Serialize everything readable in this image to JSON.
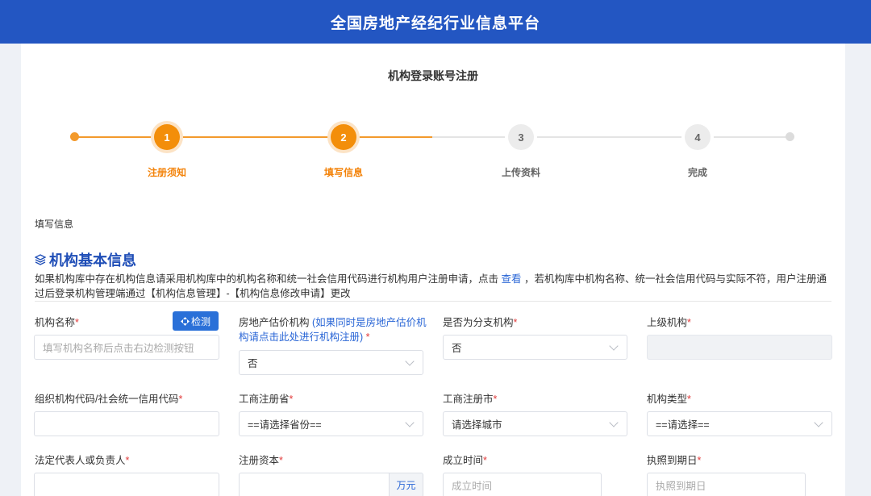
{
  "header": {
    "title": "全国房地产经纪行业信息平台"
  },
  "page": {
    "title": "机构登录账号注册"
  },
  "steps": [
    {
      "num": "1",
      "label": "注册须知",
      "state": "active"
    },
    {
      "num": "2",
      "label": "填写信息",
      "state": "active"
    },
    {
      "num": "3",
      "label": "上传资料",
      "state": "inactive"
    },
    {
      "num": "4",
      "label": "完成",
      "state": "inactive"
    }
  ],
  "breadcrumb": "填写信息",
  "section": {
    "icon": "layers-icon",
    "title": "机构基本信息",
    "notice_before": "如果机构库中存在机构信息请采用机构库中的机构名称和统一社会信用代码进行机构用户注册申请，点击 ",
    "notice_link": "查看",
    "notice_after": " ，若机构库中机构名称、统一社会信用代码与实际不符，用户注册通过后登录机构管理端通过【机构信息管理】-【机构信息修改申请】更改"
  },
  "form": {
    "org_name": {
      "label": "机构名称",
      "placeholder": "填写机构名称后点击右边检测按钮",
      "button": "检测"
    },
    "appraisal": {
      "label": "房地产估价机构",
      "hint": "(如果同时是房地产估价机构请点击此处进行机构注册)",
      "value": "否"
    },
    "branch": {
      "label": "是否为分支机构",
      "value": "否"
    },
    "parent": {
      "label": "上级机构"
    },
    "credit_code": {
      "label": "组织机构代码/社会统一信用代码"
    },
    "province": {
      "label": "工商注册省",
      "value": "==请选择省份=="
    },
    "city": {
      "label": "工商注册市",
      "value": "请选择城市"
    },
    "org_type": {
      "label": "机构类型",
      "value": "==请选择=="
    },
    "legal_rep": {
      "label": "法定代表人或负责人"
    },
    "capital": {
      "label": "注册资本",
      "unit": "万元"
    },
    "established": {
      "label": "成立时间",
      "placeholder": "成立时间"
    },
    "license_expiry": {
      "label": "执照到期日",
      "placeholder": "执照到期日"
    }
  },
  "required_mark": "*"
}
